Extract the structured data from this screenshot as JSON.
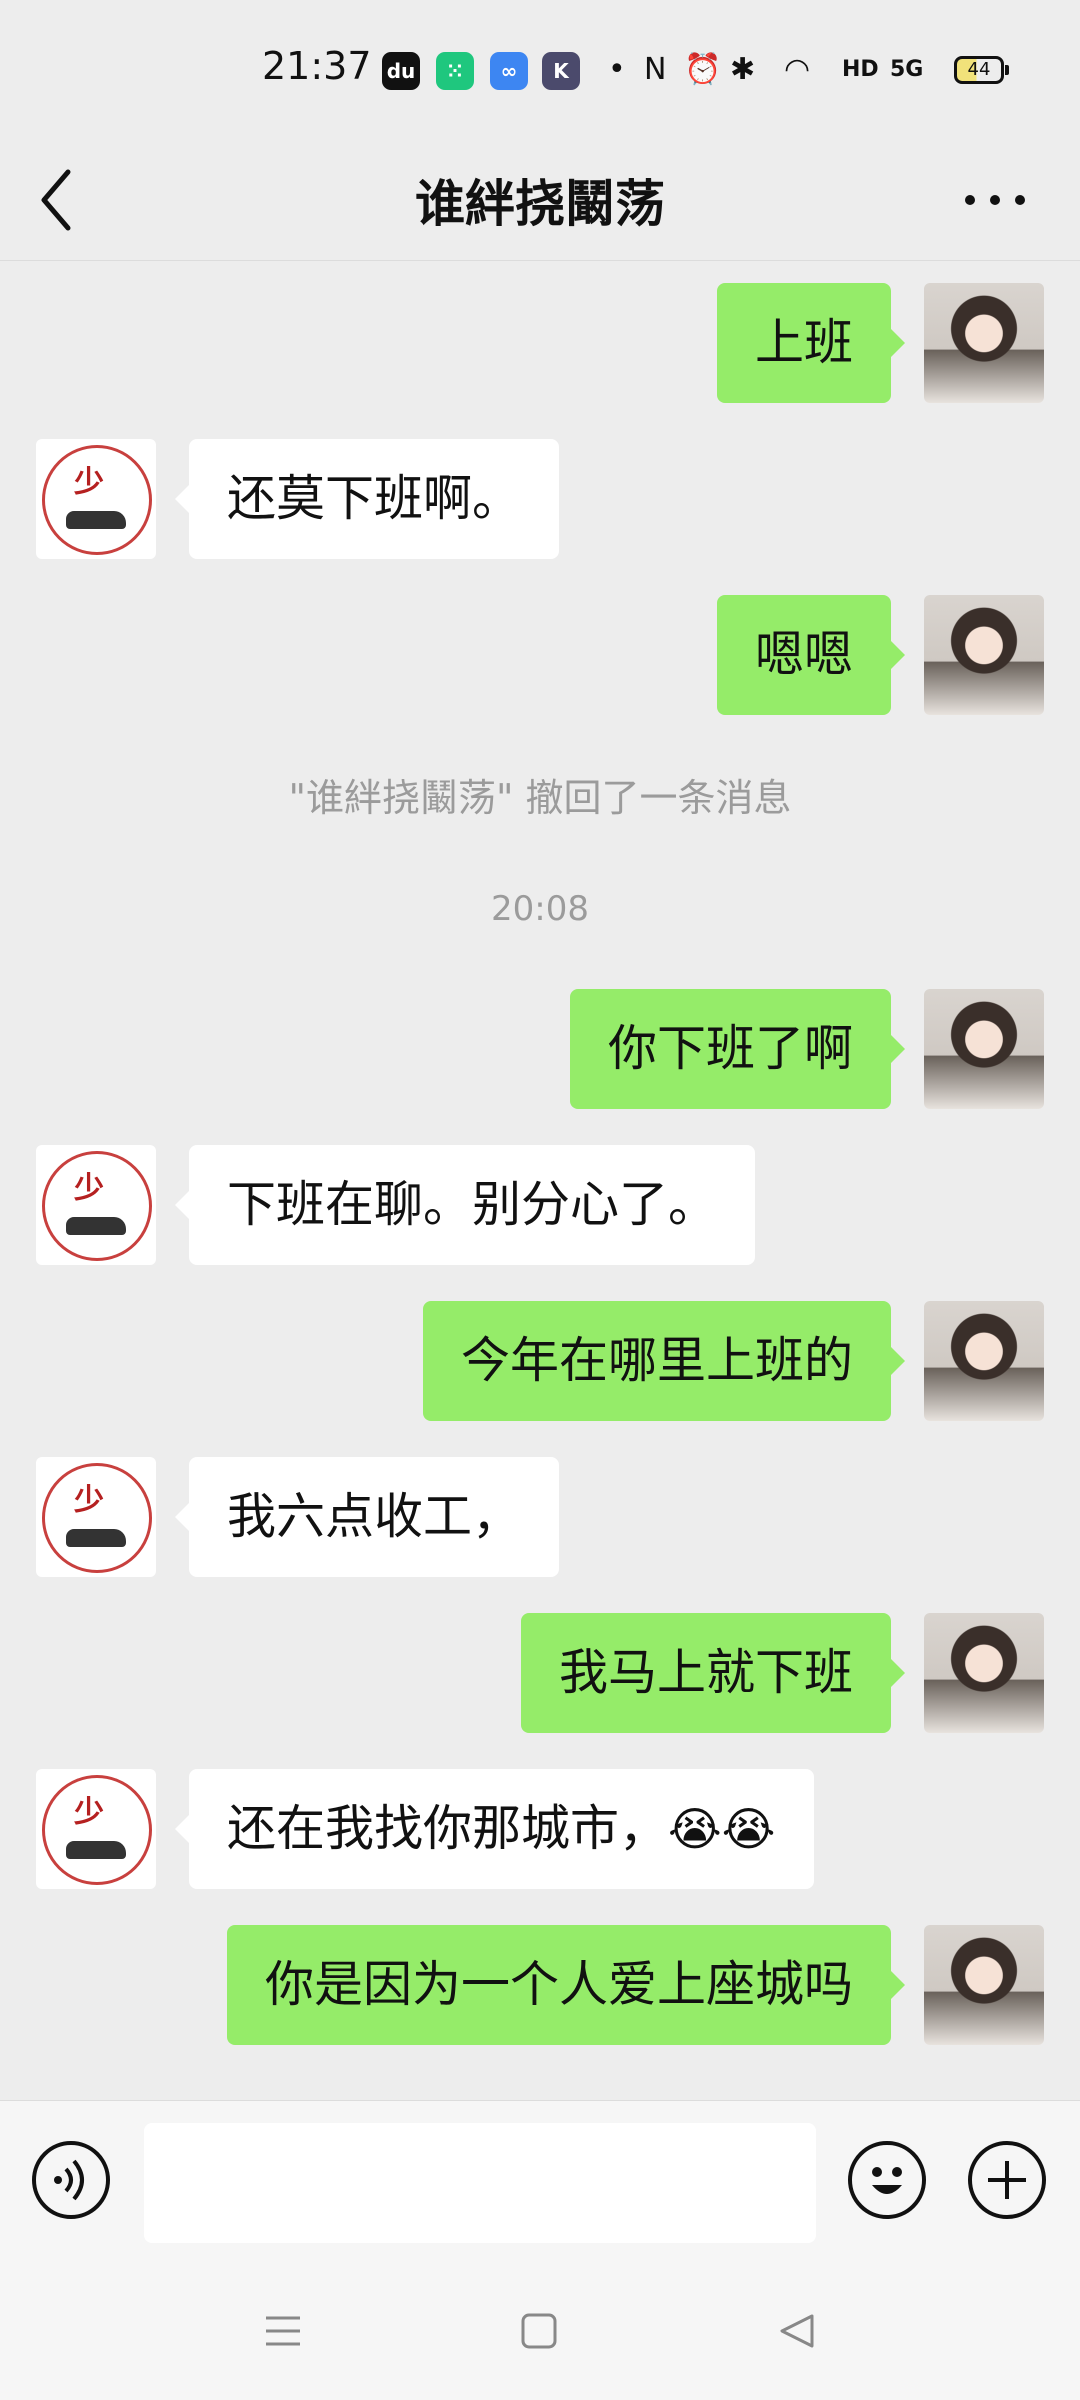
{
  "status_bar": {
    "time": "21:37",
    "app_badges": [
      {
        "name": "douyin",
        "text": "du",
        "color": "#111111"
      },
      {
        "name": "app-green",
        "text": "⁙",
        "color": "#1fc77e"
      },
      {
        "name": "app-infinity",
        "text": "∞",
        "color": "#3d86f2"
      },
      {
        "name": "app-k",
        "text": "K",
        "color": "#4b4a6c"
      }
    ],
    "network": "5G",
    "hd": "HD",
    "battery": "44"
  },
  "header": {
    "title": "谁絆挠鬫荡"
  },
  "messages": [
    {
      "direction": "out",
      "text": "上班"
    },
    {
      "direction": "in",
      "text": "还莫下班啊。"
    },
    {
      "direction": "out",
      "text": "嗯嗯"
    },
    {
      "type": "system",
      "text": "\"谁絆挠鬫荡\" 撤回了一条消息"
    },
    {
      "type": "time",
      "text": "20:08"
    },
    {
      "direction": "out",
      "text": "你下班了啊"
    },
    {
      "direction": "in",
      "text": "下班在聊。别分心了。"
    },
    {
      "direction": "out",
      "text": "今年在哪里上班的"
    },
    {
      "direction": "in",
      "text": "我六点收工，"
    },
    {
      "direction": "out",
      "text": "我马上就下班"
    },
    {
      "direction": "in",
      "text": "还在我找你那城市，",
      "emoji": "😭😭"
    },
    {
      "direction": "out",
      "text": "你是因为一个人爱上座城吗"
    }
  ],
  "input": {
    "value": "",
    "placeholder": ""
  },
  "colors": {
    "outgoing_bubble": "#95ec69",
    "incoming_bubble": "#ffffff",
    "background": "#ededed"
  }
}
